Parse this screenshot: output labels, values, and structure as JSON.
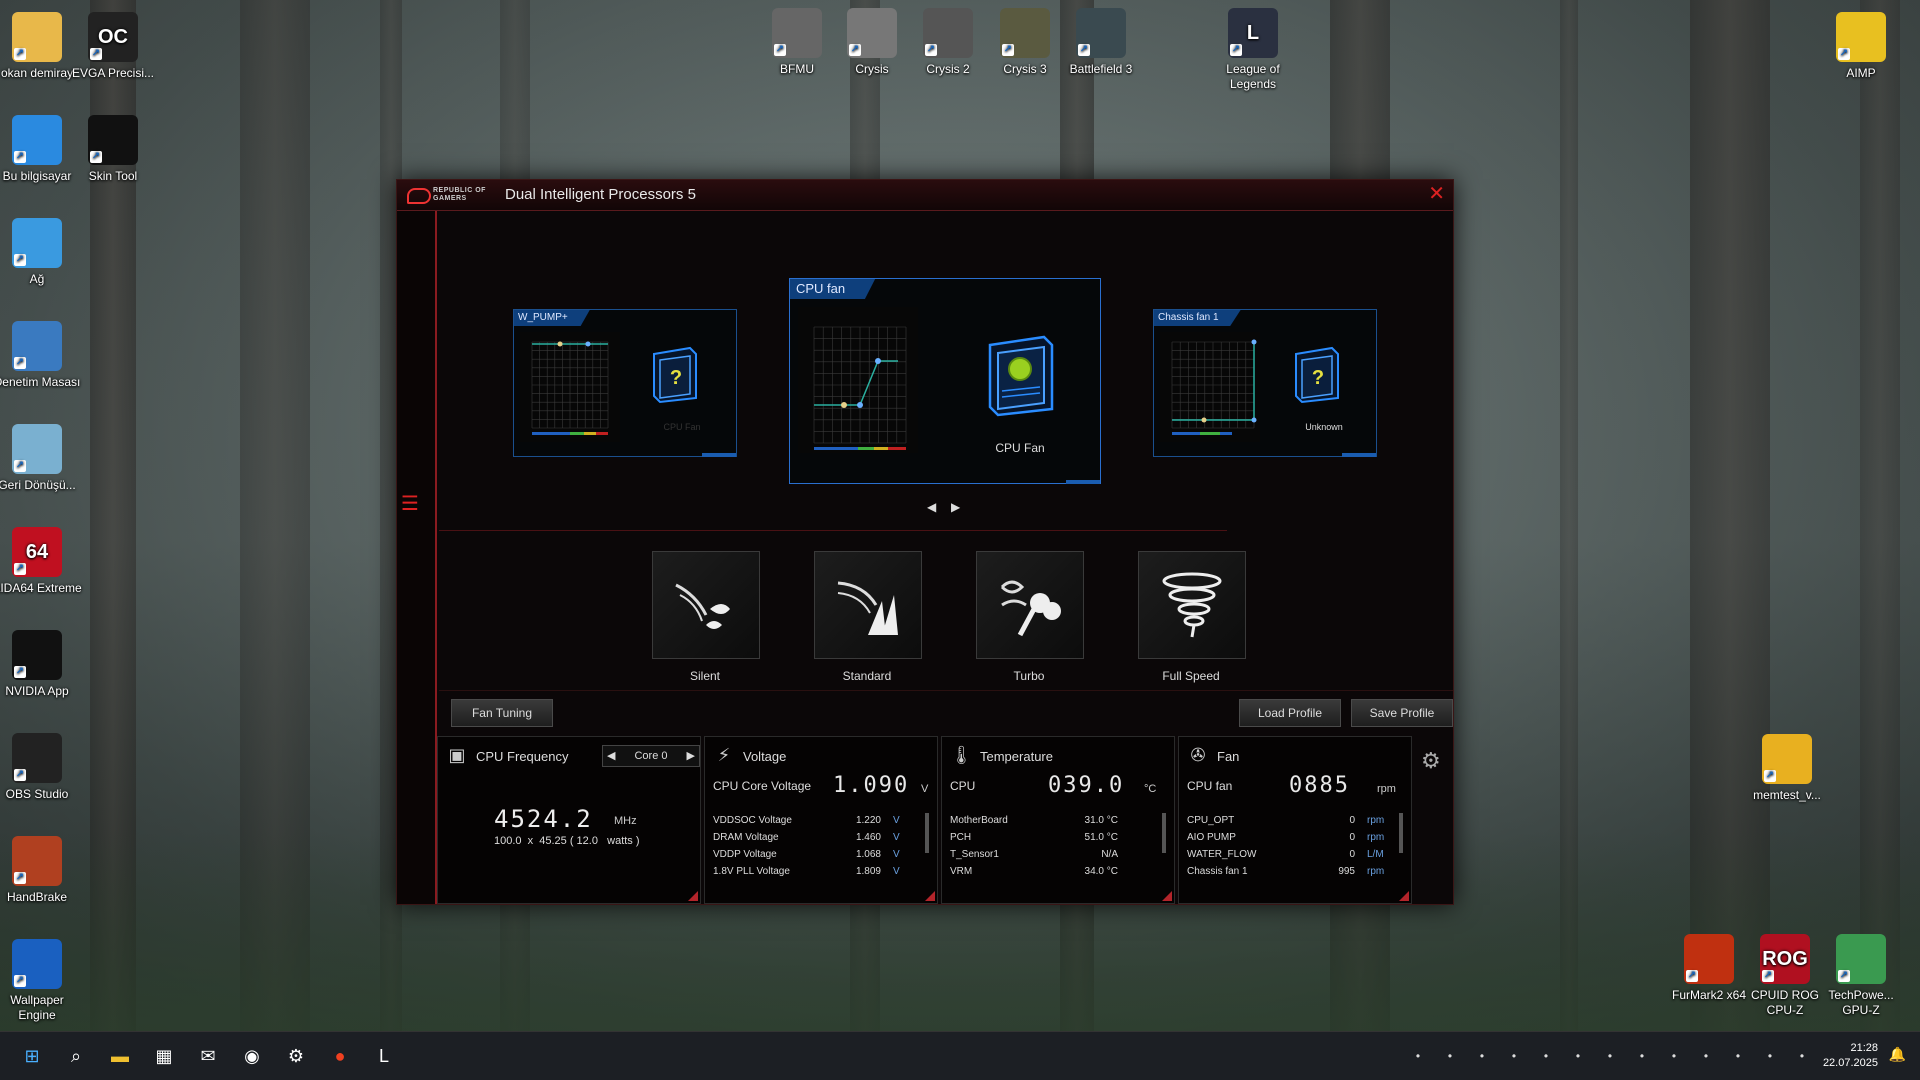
{
  "desktop": {
    "icons_left": [
      {
        "label": "okan demiray",
        "icon": "user-folder-icon"
      },
      {
        "label": "EVGA Precisi...",
        "icon": "evga-precision-icon",
        "glyph": "OC"
      },
      {
        "label": "Bu bilgisayar",
        "icon": "this-pc-icon"
      },
      {
        "label": "Skin Tool",
        "icon": "skin-tool-icon"
      },
      {
        "label": "Ağ",
        "icon": "network-icon"
      },
      {
        "label": "Denetim Masası",
        "icon": "control-panel-icon"
      },
      {
        "label": "Geri Dönüşü...",
        "icon": "recycle-bin-icon"
      },
      {
        "label": "AIDA64 Extreme",
        "icon": "aida64-icon",
        "glyph": "64"
      },
      {
        "label": "NVIDIA App",
        "icon": "nvidia-icon"
      },
      {
        "label": "OBS Studio",
        "icon": "obs-icon"
      },
      {
        "label": "HandBrake",
        "icon": "handbrake-icon"
      },
      {
        "label": "Wallpaper Engine",
        "icon": "wallpaper-engine-icon"
      }
    ],
    "icons_top": [
      {
        "label": "BFMU",
        "icon": "bfmu-icon"
      },
      {
        "label": "Crysis",
        "icon": "crysis-icon"
      },
      {
        "label": "Crysis 2",
        "icon": "crysis2-icon"
      },
      {
        "label": "Crysis 3",
        "icon": "crysis3-icon"
      },
      {
        "label": "Battlefield 3",
        "icon": "battlefield3-icon"
      },
      {
        "label": "League of Legends",
        "icon": "league-of-legends-icon",
        "glyph": "L"
      }
    ],
    "icons_right": [
      {
        "label": "AIMP",
        "icon": "aimp-icon"
      },
      {
        "label": "memtest_v...",
        "icon": "folder-icon"
      },
      {
        "label": "FurMark2 x64",
        "icon": "furmark-icon"
      },
      {
        "label": "CPUID ROG CPU-Z",
        "icon": "cpuz-icon",
        "glyph": "ROG"
      },
      {
        "label": "TechPowe... GPU-Z",
        "icon": "gpuz-icon"
      }
    ]
  },
  "window": {
    "title": "Dual Intelligent Processors 5",
    "brand_line1": "REPUBLIC OF",
    "brand_line2": "GAMERS",
    "close": "✕"
  },
  "fans": {
    "left": {
      "header": "W_PUMP+",
      "label": "CPU Fan"
    },
    "center": {
      "header": "CPU fan",
      "label": "CPU Fan"
    },
    "right": {
      "header": "Chassis fan 1",
      "label": "Unknown"
    },
    "axis_unit_y": "%",
    "axis_unit_x": "°C",
    "y_ticks": [
      "100",
      "90",
      "80",
      "70",
      "60",
      "50",
      "40",
      "30",
      "20",
      "10"
    ],
    "x_ticks": [
      "10",
      "20",
      "30",
      "40",
      "50",
      "60",
      "70",
      "80",
      "90",
      "100"
    ]
  },
  "modes": [
    {
      "label": "Silent",
      "icon": "silent-icon"
    },
    {
      "label": "Standard",
      "icon": "standard-icon"
    },
    {
      "label": "Turbo",
      "icon": "turbo-icon"
    },
    {
      "label": "Full Speed",
      "icon": "full-speed-icon"
    }
  ],
  "buttons": {
    "fan_tuning": "Fan Tuning",
    "load_profile": "Load Profile",
    "save_profile": "Save Profile"
  },
  "cpu_panel": {
    "title": "CPU Frequency",
    "core_select": "Core 0",
    "value": "4524.2",
    "unit": "MHz",
    "detail": "100.0  x  45.25 ( 12.0   watts )"
  },
  "voltage_panel": {
    "title": "Voltage",
    "main_label": "CPU Core Voltage",
    "main_value": "1.090",
    "main_unit": "V",
    "rows": [
      {
        "name": "VDDSOC Voltage",
        "value": "1.220",
        "unit": "V"
      },
      {
        "name": "DRAM Voltage",
        "value": "1.460",
        "unit": "V"
      },
      {
        "name": "VDDP Voltage",
        "value": "1.068",
        "unit": "V"
      },
      {
        "name": "1.8V PLL Voltage",
        "value": "1.809",
        "unit": "V"
      }
    ]
  },
  "temp_panel": {
    "title": "Temperature",
    "main_label": "CPU",
    "main_value": "039.0",
    "main_unit": "°C",
    "rows": [
      {
        "name": "MotherBoard",
        "value": "31.0 °C",
        "unit": ""
      },
      {
        "name": "PCH",
        "value": "51.0 °C",
        "unit": ""
      },
      {
        "name": "T_Sensor1",
        "value": "N/A",
        "unit": ""
      },
      {
        "name": "VRM",
        "value": "34.0 °C",
        "unit": ""
      }
    ]
  },
  "fan_panel": {
    "title": "Fan",
    "main_label": "CPU fan",
    "main_value": "0885",
    "main_unit": "rpm",
    "rows": [
      {
        "name": "CPU_OPT",
        "value": "0",
        "unit": "rpm"
      },
      {
        "name": "AIO PUMP",
        "value": "0",
        "unit": "rpm"
      },
      {
        "name": "WATER_FLOW",
        "value": "0",
        "unit": "L/M"
      },
      {
        "name": "Chassis fan 1",
        "value": "995",
        "unit": "rpm"
      }
    ]
  },
  "taskbar": {
    "time": "21:28",
    "date": "22.07.2025",
    "apps": [
      "start-icon",
      "search-icon",
      "file-explorer-icon",
      "store-icon",
      "outlook-icon",
      "chrome-icon",
      "steam-icon",
      "ea-icon",
      "league-client-icon"
    ],
    "tray": [
      "nvidia-tray-icon",
      "record-tray-icon",
      "vpn-tray-icon",
      "network-tray-icon",
      "app-tray-icon",
      "steam-tray-icon",
      "logitech-tray-icon",
      "msi-tray-icon",
      "wifi-tray-icon",
      "settings-tray-icon",
      "security-tray-icon",
      "display-tray-icon",
      "volume-tray-icon"
    ]
  }
}
